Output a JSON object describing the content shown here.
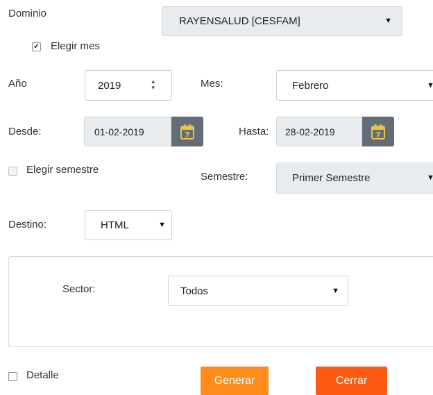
{
  "dominio": {
    "label": "Dominio",
    "value": "RAYENSALUD [CESFAM]"
  },
  "elegir_mes": {
    "label": "Elegir mes",
    "checked": true
  },
  "anio": {
    "label": "Año",
    "value": "2019"
  },
  "mes": {
    "label": "Mes:",
    "value": "Febrero"
  },
  "desde": {
    "label": "Desde:",
    "value": "01-02-2019",
    "calendar_day": "7"
  },
  "hasta": {
    "label": "Hasta:",
    "value": "28-02-2019",
    "calendar_day": "7"
  },
  "elegir_semestre": {
    "label": "Elegir semestre",
    "checked": false,
    "disabled": true
  },
  "semestre": {
    "label": "Semestre:",
    "value": "Primer Semestre"
  },
  "destino": {
    "label": "Destino:",
    "value": "HTML"
  },
  "sector": {
    "label": "Sector:",
    "value": "Todos"
  },
  "detalle": {
    "label": "Detalle",
    "checked": false
  },
  "buttons": {
    "generar": "Generar",
    "cerrar": "Cerrar"
  },
  "colors": {
    "generar": "#ff8c1a",
    "cerrar": "#ff5a12",
    "calendar": "#636d77",
    "grey_field": "#e9ecef"
  },
  "icons": {
    "calendar": "calendar-icon",
    "select": "caret-down-icon",
    "spinner": "spinner-arrows-icon",
    "check": "checkmark-icon"
  }
}
